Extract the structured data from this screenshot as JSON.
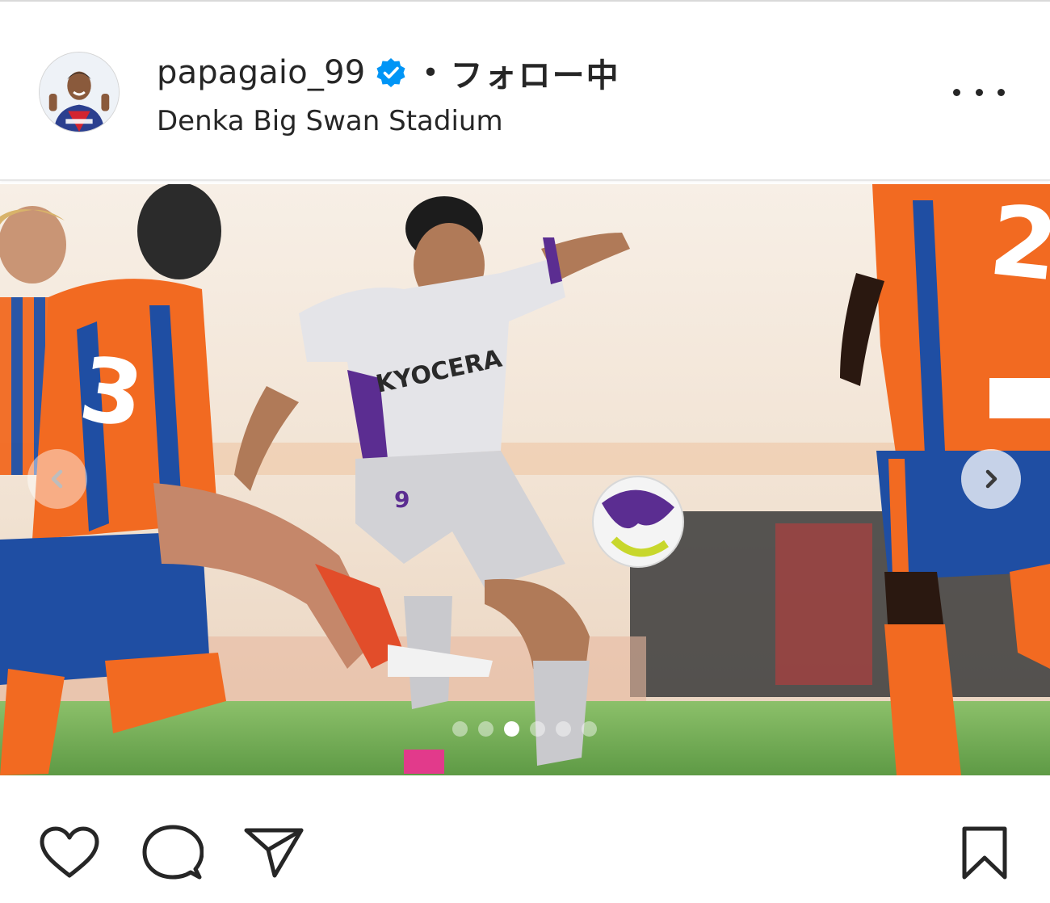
{
  "post": {
    "username": "papagaio_99",
    "separator": "•",
    "follow_status": "フォロー中",
    "location": "Denka Big Swan Stadium"
  },
  "icons": {
    "verified": "verified-badge-icon",
    "more": "more-options-icon",
    "prev": "chevron-left-icon",
    "next": "chevron-right-icon",
    "like": "heart-icon",
    "comment": "comment-icon",
    "share": "send-icon",
    "save": "bookmark-icon"
  },
  "carousel": {
    "total": 6,
    "active_index": 2
  },
  "colors": {
    "text": "#262626",
    "verified": "#0095f6",
    "home_orange": "#f26a21",
    "home_blue": "#1f4ea3",
    "away_kit": "#d9d9dc",
    "away_purple": "#5b2d91"
  }
}
